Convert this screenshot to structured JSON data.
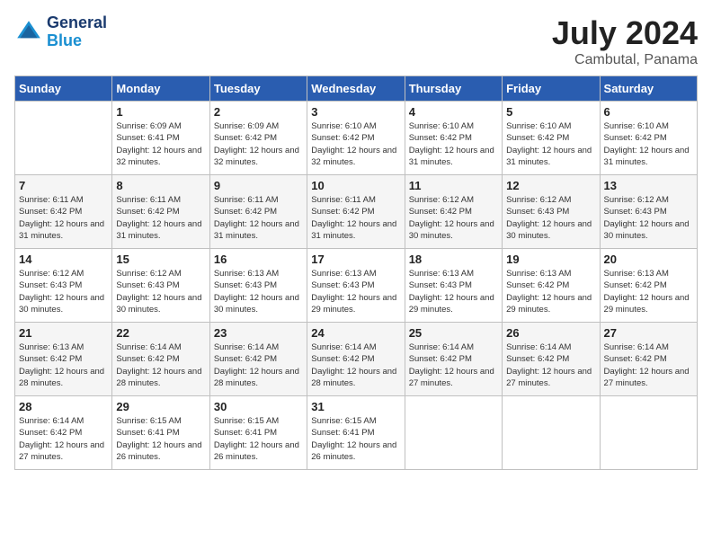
{
  "header": {
    "logo_line1": "General",
    "logo_line2": "Blue",
    "month_title": "July 2024",
    "location": "Cambutal, Panama"
  },
  "days_of_week": [
    "Sunday",
    "Monday",
    "Tuesday",
    "Wednesday",
    "Thursday",
    "Friday",
    "Saturday"
  ],
  "weeks": [
    [
      {
        "day": "",
        "empty": true
      },
      {
        "day": "1",
        "sunrise": "6:09 AM",
        "sunset": "6:41 PM",
        "daylight": "12 hours and 32 minutes."
      },
      {
        "day": "2",
        "sunrise": "6:09 AM",
        "sunset": "6:42 PM",
        "daylight": "12 hours and 32 minutes."
      },
      {
        "day": "3",
        "sunrise": "6:10 AM",
        "sunset": "6:42 PM",
        "daylight": "12 hours and 32 minutes."
      },
      {
        "day": "4",
        "sunrise": "6:10 AM",
        "sunset": "6:42 PM",
        "daylight": "12 hours and 31 minutes."
      },
      {
        "day": "5",
        "sunrise": "6:10 AM",
        "sunset": "6:42 PM",
        "daylight": "12 hours and 31 minutes."
      },
      {
        "day": "6",
        "sunrise": "6:10 AM",
        "sunset": "6:42 PM",
        "daylight": "12 hours and 31 minutes."
      }
    ],
    [
      {
        "day": "7",
        "sunrise": "6:11 AM",
        "sunset": "6:42 PM",
        "daylight": "12 hours and 31 minutes."
      },
      {
        "day": "8",
        "sunrise": "6:11 AM",
        "sunset": "6:42 PM",
        "daylight": "12 hours and 31 minutes."
      },
      {
        "day": "9",
        "sunrise": "6:11 AM",
        "sunset": "6:42 PM",
        "daylight": "12 hours and 31 minutes."
      },
      {
        "day": "10",
        "sunrise": "6:11 AM",
        "sunset": "6:42 PM",
        "daylight": "12 hours and 31 minutes."
      },
      {
        "day": "11",
        "sunrise": "6:12 AM",
        "sunset": "6:42 PM",
        "daylight": "12 hours and 30 minutes."
      },
      {
        "day": "12",
        "sunrise": "6:12 AM",
        "sunset": "6:43 PM",
        "daylight": "12 hours and 30 minutes."
      },
      {
        "day": "13",
        "sunrise": "6:12 AM",
        "sunset": "6:43 PM",
        "daylight": "12 hours and 30 minutes."
      }
    ],
    [
      {
        "day": "14",
        "sunrise": "6:12 AM",
        "sunset": "6:43 PM",
        "daylight": "12 hours and 30 minutes."
      },
      {
        "day": "15",
        "sunrise": "6:12 AM",
        "sunset": "6:43 PM",
        "daylight": "12 hours and 30 minutes."
      },
      {
        "day": "16",
        "sunrise": "6:13 AM",
        "sunset": "6:43 PM",
        "daylight": "12 hours and 30 minutes."
      },
      {
        "day": "17",
        "sunrise": "6:13 AM",
        "sunset": "6:43 PM",
        "daylight": "12 hours and 29 minutes."
      },
      {
        "day": "18",
        "sunrise": "6:13 AM",
        "sunset": "6:43 PM",
        "daylight": "12 hours and 29 minutes."
      },
      {
        "day": "19",
        "sunrise": "6:13 AM",
        "sunset": "6:42 PM",
        "daylight": "12 hours and 29 minutes."
      },
      {
        "day": "20",
        "sunrise": "6:13 AM",
        "sunset": "6:42 PM",
        "daylight": "12 hours and 29 minutes."
      }
    ],
    [
      {
        "day": "21",
        "sunrise": "6:13 AM",
        "sunset": "6:42 PM",
        "daylight": "12 hours and 28 minutes."
      },
      {
        "day": "22",
        "sunrise": "6:14 AM",
        "sunset": "6:42 PM",
        "daylight": "12 hours and 28 minutes."
      },
      {
        "day": "23",
        "sunrise": "6:14 AM",
        "sunset": "6:42 PM",
        "daylight": "12 hours and 28 minutes."
      },
      {
        "day": "24",
        "sunrise": "6:14 AM",
        "sunset": "6:42 PM",
        "daylight": "12 hours and 28 minutes."
      },
      {
        "day": "25",
        "sunrise": "6:14 AM",
        "sunset": "6:42 PM",
        "daylight": "12 hours and 27 minutes."
      },
      {
        "day": "26",
        "sunrise": "6:14 AM",
        "sunset": "6:42 PM",
        "daylight": "12 hours and 27 minutes."
      },
      {
        "day": "27",
        "sunrise": "6:14 AM",
        "sunset": "6:42 PM",
        "daylight": "12 hours and 27 minutes."
      }
    ],
    [
      {
        "day": "28",
        "sunrise": "6:14 AM",
        "sunset": "6:42 PM",
        "daylight": "12 hours and 27 minutes."
      },
      {
        "day": "29",
        "sunrise": "6:15 AM",
        "sunset": "6:41 PM",
        "daylight": "12 hours and 26 minutes."
      },
      {
        "day": "30",
        "sunrise": "6:15 AM",
        "sunset": "6:41 PM",
        "daylight": "12 hours and 26 minutes."
      },
      {
        "day": "31",
        "sunrise": "6:15 AM",
        "sunset": "6:41 PM",
        "daylight": "12 hours and 26 minutes."
      },
      {
        "day": "",
        "empty": true
      },
      {
        "day": "",
        "empty": true
      },
      {
        "day": "",
        "empty": true
      }
    ]
  ]
}
